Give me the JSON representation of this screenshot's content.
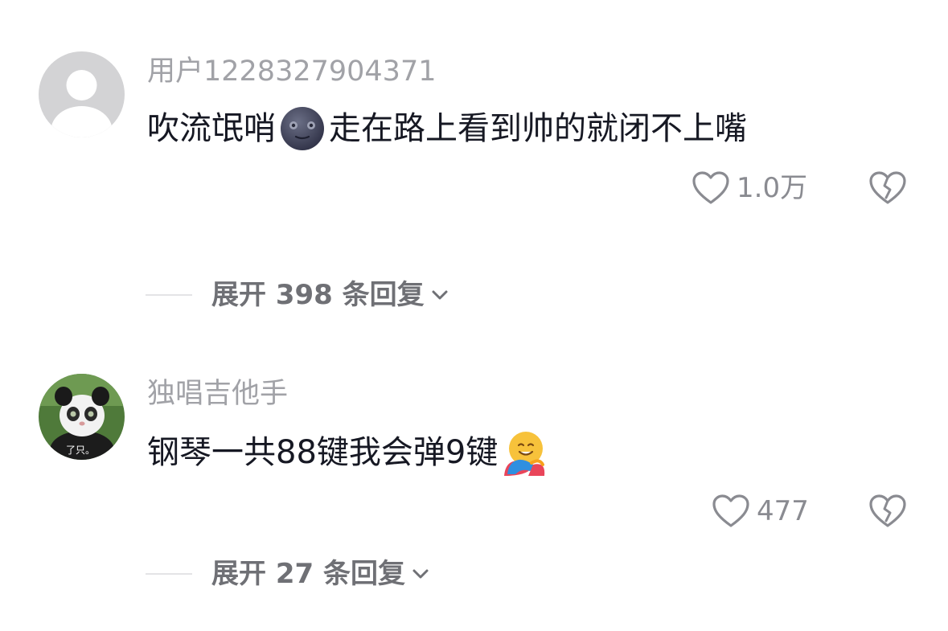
{
  "comments": [
    {
      "username": "用户1228327904371",
      "text_before": "吹流氓哨",
      "emoji": "new-moon-face-emoji",
      "text_after": " 走在路上看到帅的就闭不上嘴",
      "like_count": "1.0万",
      "replies_label": "展开 398 条回复",
      "avatar": "default-avatar"
    },
    {
      "username": "独唱吉他手",
      "text_before": "钢琴一共88键我会弹9键",
      "emoji": "hugging-face-emoji",
      "text_after": "",
      "like_count": "477",
      "replies_label": "展开 27 条回复",
      "avatar": "panda-cat-avatar",
      "avatar_caption": "了只。"
    }
  ],
  "colors": {
    "username": "#a1a2a7",
    "text": "#161823",
    "meta": "#8a8b91",
    "replies": "#6f7075"
  }
}
